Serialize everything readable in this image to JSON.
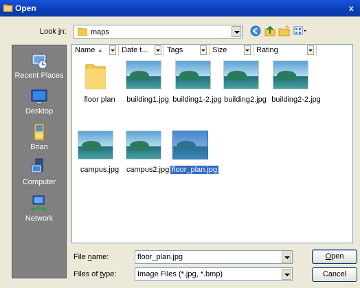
{
  "window": {
    "title": "Open",
    "close_label": "x"
  },
  "toolbar": {
    "look_in_label_pre": "Look ",
    "look_in_label_acc": "i",
    "look_in_label_post": "n:",
    "look_in_value": "maps",
    "icons": [
      "back-icon",
      "up-folder-icon",
      "new-folder-icon",
      "views-menu-icon"
    ]
  },
  "places": [
    {
      "label": "Recent Places",
      "icon": "recent-places-icon"
    },
    {
      "label": "Desktop",
      "icon": "desktop-icon"
    },
    {
      "label": "Brian",
      "icon": "user-folder-icon"
    },
    {
      "label": "Computer",
      "icon": "computer-icon"
    },
    {
      "label": "Network",
      "icon": "network-icon"
    }
  ],
  "columns": [
    "Name",
    "Date t...",
    "Tags",
    "Size",
    "Rating"
  ],
  "files": [
    {
      "name": "floor plan",
      "kind": "folder"
    },
    {
      "name": "building1.jpg",
      "kind": "image"
    },
    {
      "name": "building1-2.jpg",
      "kind": "image"
    },
    {
      "name": "building2.jpg",
      "kind": "image"
    },
    {
      "name": "building2-2.jpg",
      "kind": "image"
    },
    {
      "name": "campus.jpg",
      "kind": "image"
    },
    {
      "name": "campus2.jpg",
      "kind": "image"
    },
    {
      "name": "floor_plan.jpg",
      "kind": "image",
      "selected": true
    }
  ],
  "file_name": {
    "label_pre": "File ",
    "label_acc": "n",
    "label_post": "ame:",
    "value": "floor_plan.jpg"
  },
  "file_type": {
    "label_pre": "Files of ",
    "label_acc": "t",
    "label_post": "ype:",
    "value": "Image Files (*.jpg, *.bmp)"
  },
  "buttons": {
    "open_acc": "O",
    "open_rest": "pen",
    "cancel": "Cancel"
  },
  "colors": {
    "title_bar": "#0a3fb8",
    "selection": "#316ac5",
    "places_bg": "#808080",
    "dialog_bg": "#ece9d8"
  }
}
